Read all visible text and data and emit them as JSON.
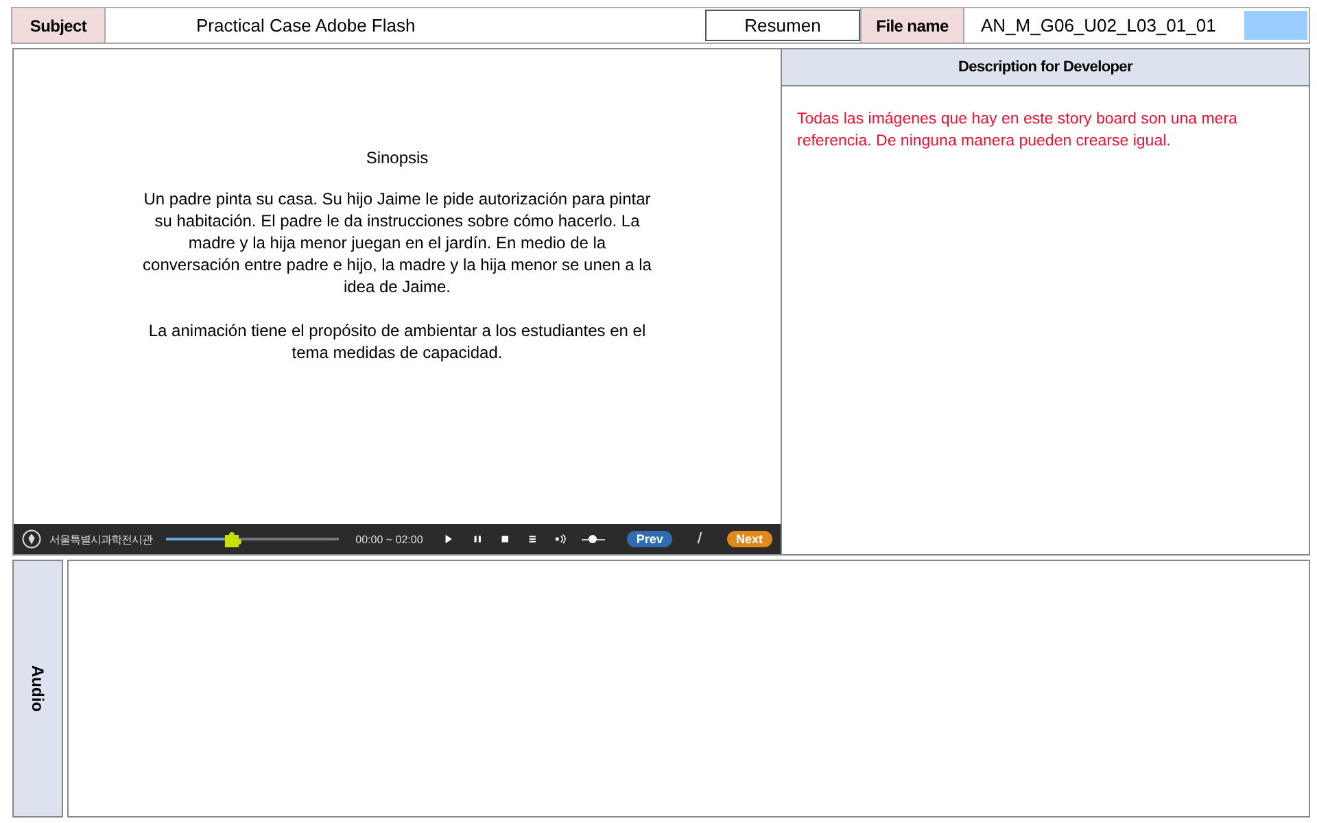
{
  "header": {
    "subject_label": "Subject",
    "subject": "Practical Case Adobe Flash",
    "section": "Resumen",
    "file_label": "File name",
    "file_name": "AN_M_G06_U02_L03_01_01"
  },
  "stage": {
    "title": "Sinopsis",
    "paragraphs": [
      "Un padre pinta su casa. Su hijo Jaime le pide autorización para pintar su habitación. El padre le da instrucciones sobre cómo hacerlo. La madre y la hija menor juegan en el jardín. En medio de la conversación entre padre e hijo, la madre y la hija menor se unen a la idea de Jaime.",
      "La animación tiene el propósito de ambientar a los estudiantes en el tema medidas de capacidad."
    ]
  },
  "player": {
    "brand": "서울특별시과학전시관",
    "progress": {
      "level": 0.38
    },
    "time": "00:00 ~ 02:00",
    "volume": {
      "level": 0.5
    },
    "prev": "Prev",
    "separator": "/",
    "next": "Next"
  },
  "developer": {
    "title": "Description for Developer",
    "note": "Todas las imágenes que hay en este story board son una mera referencia. De ninguna manera pueden crearse igual."
  },
  "audio": {
    "label": "Audio"
  }
}
